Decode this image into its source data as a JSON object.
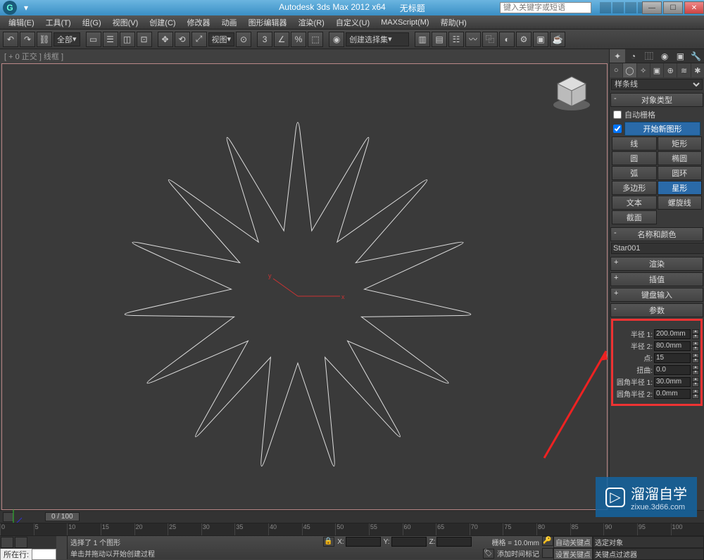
{
  "titlebar": {
    "app": "Autodesk 3ds Max 2012 x64",
    "doc": "无标题",
    "search_placeholder": "键入关键字或短语"
  },
  "menu": [
    "编辑(E)",
    "工具(T)",
    "组(G)",
    "视图(V)",
    "创建(C)",
    "修改器",
    "动画",
    "图形编辑器",
    "渲染(R)",
    "自定义(U)",
    "MAXScript(M)",
    "帮助(H)"
  ],
  "toolbar": {
    "filter": "全部",
    "viewbtn": "视图",
    "selset": "创建选择集"
  },
  "viewport": {
    "label": "[ + 0 正交 ] 线框 ]"
  },
  "cmdpanel": {
    "shapeDropdown": "样条线",
    "rollouts": {
      "objtype": "对象类型",
      "autogrid": "自动栅格",
      "newshape": "开始新图形",
      "namecolor": "名称和颜色",
      "render": "渲染",
      "interp": "插值",
      "keyboard": "键盘输入",
      "params": "参数"
    },
    "shapes": [
      [
        "线",
        "矩形"
      ],
      [
        "圆",
        "椭圆"
      ],
      [
        "弧",
        "圆环"
      ],
      [
        "多边形",
        "星形"
      ],
      [
        "文本",
        "螺旋线"
      ],
      [
        "截面",
        ""
      ]
    ],
    "objname": "Star001",
    "params": {
      "r1_lbl": "半径 1:",
      "r1": "200.0mm",
      "r2_lbl": "半径 2:",
      "r2": "80.0mm",
      "pts_lbl": "点:",
      "pts": "15",
      "dist_lbl": "扭曲:",
      "dist": "0.0",
      "f1_lbl": "圆角半径 1:",
      "f1": "30.0mm",
      "f2_lbl": "圆角半径 2:",
      "f2": "0.0mm"
    }
  },
  "timeslider": {
    "pos": "0 / 100"
  },
  "status": {
    "sel": "选择了 1 个图形",
    "hint": "单击并拖动以开始创建过程",
    "x": "X:",
    "y": "Y:",
    "z": "Z:",
    "grid": "栅格 = 10.0mm",
    "addtime": "添加时间标记",
    "autokey": "自动关键点",
    "selfilter": "选定对象",
    "setkey": "设置关键点",
    "keyfilter": "关键点过滤器"
  },
  "prompt": {
    "label": "所在行:"
  },
  "watermark": {
    "main": "溜溜自学",
    "sub": "zixue.3d66.com"
  }
}
